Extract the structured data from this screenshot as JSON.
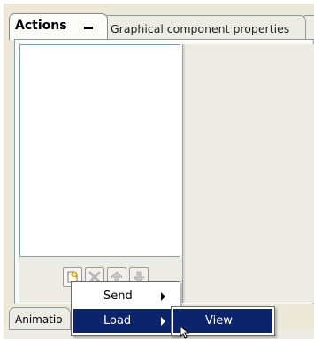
{
  "tabs": {
    "actions_label": "Actions",
    "graphical_label": "Graphical component properties"
  },
  "toolbar": {
    "buttons": [
      "new-action-icon",
      "delete-icon",
      "move-up-icon",
      "move-down-icon"
    ]
  },
  "bottom_tab": {
    "label": "Animatio"
  },
  "context_menu": {
    "items": [
      {
        "label": "Send",
        "has_submenu": true
      },
      {
        "label": "Load",
        "has_submenu": true,
        "highlighted": true
      }
    ],
    "submenu": {
      "items": [
        {
          "label": "View",
          "highlighted": true
        }
      ]
    }
  },
  "colors": {
    "highlight": "#0b246b",
    "panel_bg": "#ecebe4",
    "list_border": "#7f9db9"
  }
}
